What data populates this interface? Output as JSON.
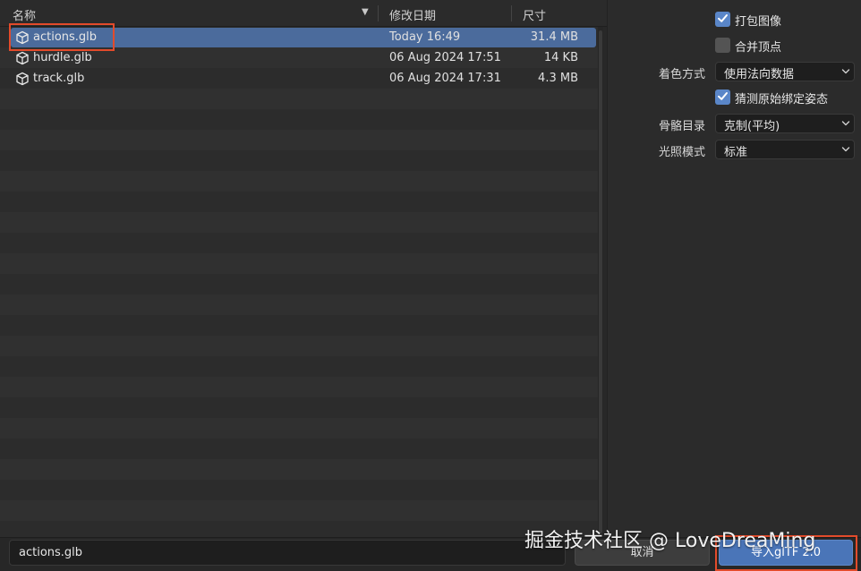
{
  "columns": {
    "name": "名称",
    "modified": "修改日期",
    "size": "尺寸"
  },
  "files": [
    {
      "name": "actions.glb",
      "date": "Today 16:49",
      "size": "31.4 MB",
      "selected": true
    },
    {
      "name": "hurdle.glb",
      "date": "06 Aug 2024 17:51",
      "size": "14 KB",
      "selected": false
    },
    {
      "name": "track.glb",
      "date": "06 Aug 2024 17:31",
      "size": "4.3 MB",
      "selected": false
    }
  ],
  "options": {
    "pack_images": {
      "label": "打包图像",
      "checked": true
    },
    "merge_vertices": {
      "label": "合并顶点",
      "checked": false
    },
    "shading": {
      "label": "着色方式",
      "value": "使用法向数据"
    },
    "guess_bind_pose": {
      "label": "猜测原始绑定姿态",
      "checked": true
    },
    "bone_dir": {
      "label": "骨骼目录",
      "value": "克制(平均)"
    },
    "lighting_mode": {
      "label": "光照模式",
      "value": "标准"
    }
  },
  "bottom": {
    "filename": "actions.glb",
    "cancel_label": "取消",
    "import_label": "导入glTF 2.0"
  },
  "watermark": "掘金技术社区 @ LoveDreaMing",
  "colors": {
    "accent": "#4a75b8",
    "selection": "#4b6b9c",
    "highlight_box": "#e34b2b"
  }
}
